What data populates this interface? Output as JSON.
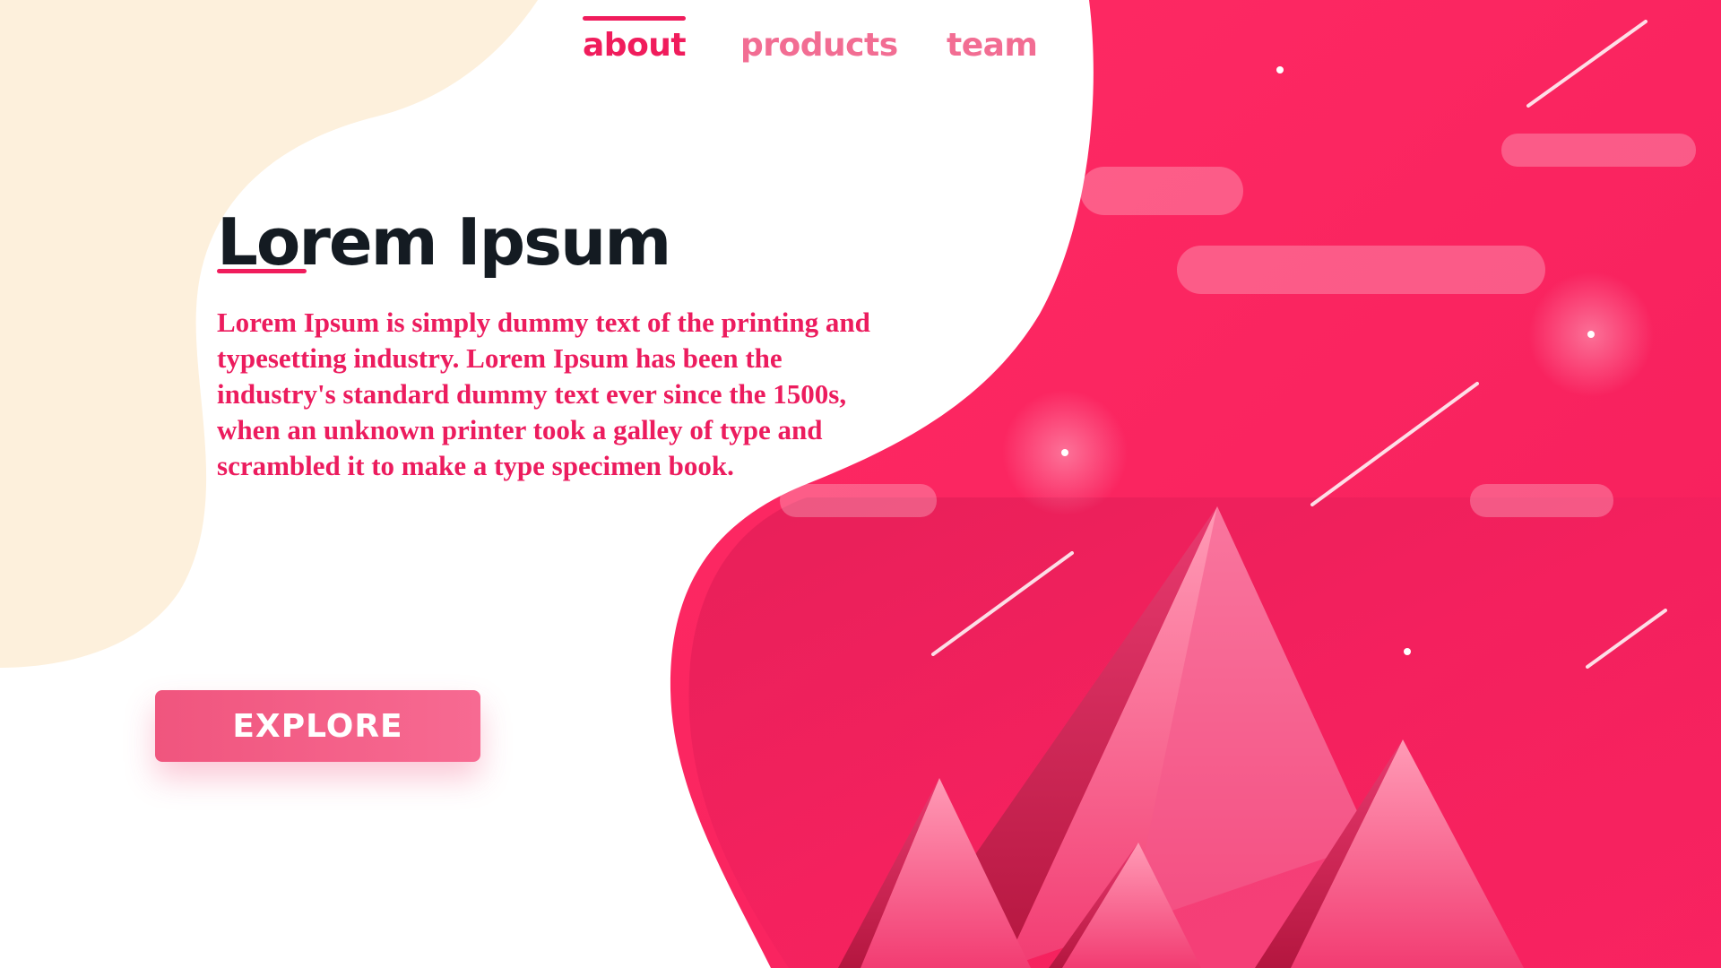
{
  "nav": {
    "items": [
      {
        "label": "about",
        "active": true
      },
      {
        "label": "products",
        "active": false
      },
      {
        "label": "team",
        "active": false
      }
    ]
  },
  "hero": {
    "title": "Lorem Ipsum",
    "body": "Lorem Ipsum is simply dummy text of the printing and typesetting industry. Lorem Ipsum has been the industry's standard dummy text ever since the 1500s, when an unknown printer took a galley of type and scrambled it to make a type specimen book.",
    "cta_label": "EXPLORE"
  },
  "colors": {
    "primary_pink": "#f01c5c",
    "light_pink": "#f26d93",
    "cream": "#fdf0dc",
    "dark_text": "#141b22"
  }
}
